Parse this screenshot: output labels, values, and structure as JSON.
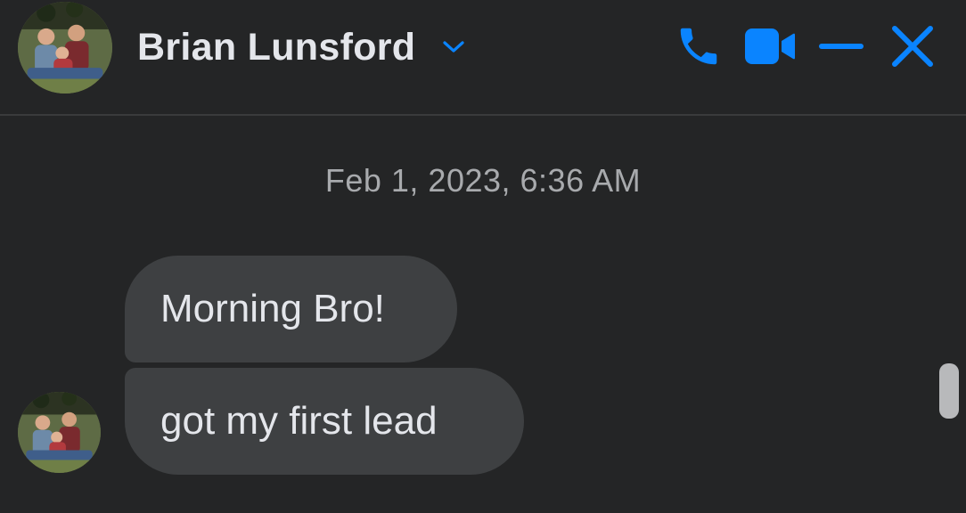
{
  "header": {
    "contact_name": "Brian Lunsford",
    "avatar_icon": "profile-photo",
    "dropdown_icon": "chevron-down-icon",
    "actions": [
      {
        "name": "voice-call-button",
        "icon": "phone-icon"
      },
      {
        "name": "video-call-button",
        "icon": "video-camera-icon"
      },
      {
        "name": "minimize-button",
        "icon": "minimize-icon"
      },
      {
        "name": "close-button",
        "icon": "close-icon"
      }
    ]
  },
  "conversation": {
    "timestamp": "Feb 1, 2023, 6:36 AM",
    "messages": [
      {
        "text": "Morning Bro!"
      },
      {
        "text": "got my first lead"
      }
    ]
  },
  "colors": {
    "background": "#242526",
    "accent": "#0a84ff",
    "bubble": "#3e4042",
    "text": "#e4e6eb",
    "timestamp": "#a8aaad"
  }
}
